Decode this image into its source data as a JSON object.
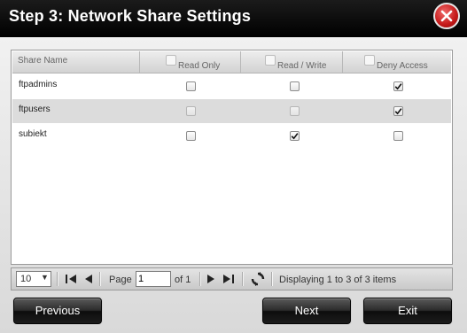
{
  "dialog": {
    "title": "Step 3: Network Share Settings"
  },
  "table": {
    "columns": {
      "share_name": "Share Name",
      "read_only": "Read Only",
      "read_write": "Read / Write",
      "deny_access": "Deny Access"
    },
    "rows": [
      {
        "name": "ftpadmins",
        "read_only": false,
        "read_write": false,
        "deny_access": true
      },
      {
        "name": "ftpusers",
        "read_only": false,
        "read_write": false,
        "deny_access": true
      },
      {
        "name": "subiekt",
        "read_only": false,
        "read_write": true,
        "deny_access": false
      }
    ]
  },
  "pager": {
    "page_size": "10",
    "page_label": "Page",
    "page_value": "1",
    "of_label": "of 1",
    "status": "Displaying 1 to 3 of 3 items"
  },
  "buttons": {
    "previous": "Previous",
    "next": "Next",
    "exit": "Exit"
  }
}
